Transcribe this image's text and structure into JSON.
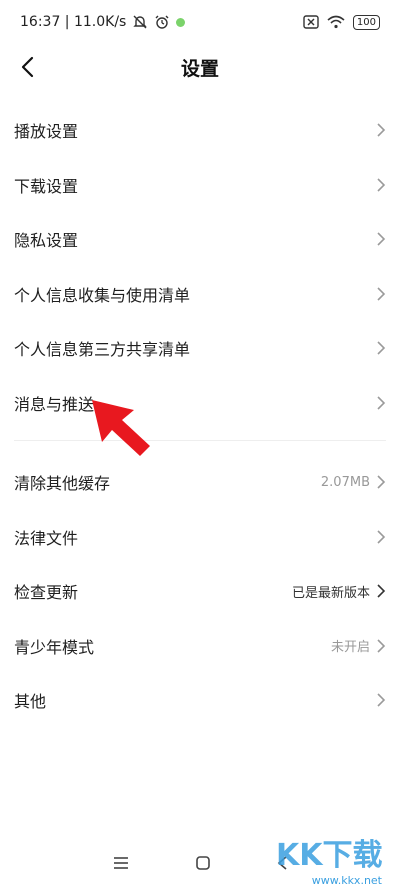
{
  "status_bar": {
    "time_speed": "16:37 | 11.0K/s",
    "battery": "100"
  },
  "header": {
    "title": "设置"
  },
  "section1": [
    {
      "label": "播放设置"
    },
    {
      "label": "下载设置"
    },
    {
      "label": "隐私设置"
    },
    {
      "label": "个人信息收集与使用清单"
    },
    {
      "label": "个人信息第三方共享清单"
    },
    {
      "label": "消息与推送"
    }
  ],
  "section2": [
    {
      "label": "清除其他缓存",
      "value": "2.07MB"
    },
    {
      "label": "法律文件"
    },
    {
      "label": "检查更新",
      "value": "已是最新版本"
    },
    {
      "label": "青少年模式",
      "value": "未开启"
    },
    {
      "label": "其他"
    }
  ],
  "watermark": {
    "brand": "KK下载",
    "url": "www.kkx.net"
  },
  "colors": {
    "annotation_arrow": "#e8181f",
    "chevron": "#9a9a9a",
    "watermark": "#3a9fe0"
  }
}
